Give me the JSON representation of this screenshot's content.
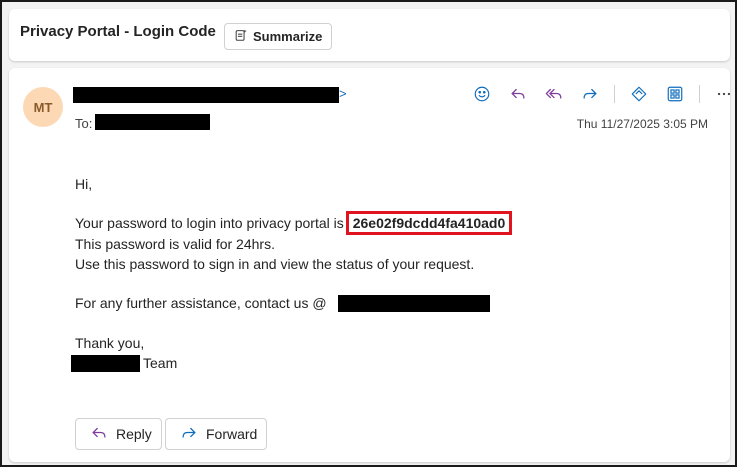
{
  "subject": {
    "title": "Privacy Portal - Login Code",
    "summarize_label": "Summarize"
  },
  "header": {
    "avatar_initials": "MT",
    "from_suffix": ">",
    "to_label": "To:",
    "date": "Thu 11/27/2025 3:05 PM"
  },
  "toolbar_icons": [
    "smiley-icon",
    "reply-icon",
    "reply-all-icon",
    "forward-icon",
    "immersive-reader-icon",
    "apps-icon",
    "more-icon"
  ],
  "body": {
    "greeting": "Hi,",
    "line1_prefix": "Your password to login into privacy portal is",
    "code": "26e02f9dcdd4fa410ad0",
    "line2": "This password is valid for 24hrs.",
    "line3": "Use this password to sign in and view the status of your request.",
    "assistance": "For any further assistance, contact us @",
    "thanks": "Thank you,",
    "team_suffix": "Team"
  },
  "actions": {
    "reply_label": "Reply",
    "forward_label": "Forward"
  },
  "colors": {
    "accent": "#0f6cbd",
    "reply_purple": "#7c3d9b",
    "highlight": "#e0141e",
    "avatar_bg": "#fcd9b4"
  }
}
